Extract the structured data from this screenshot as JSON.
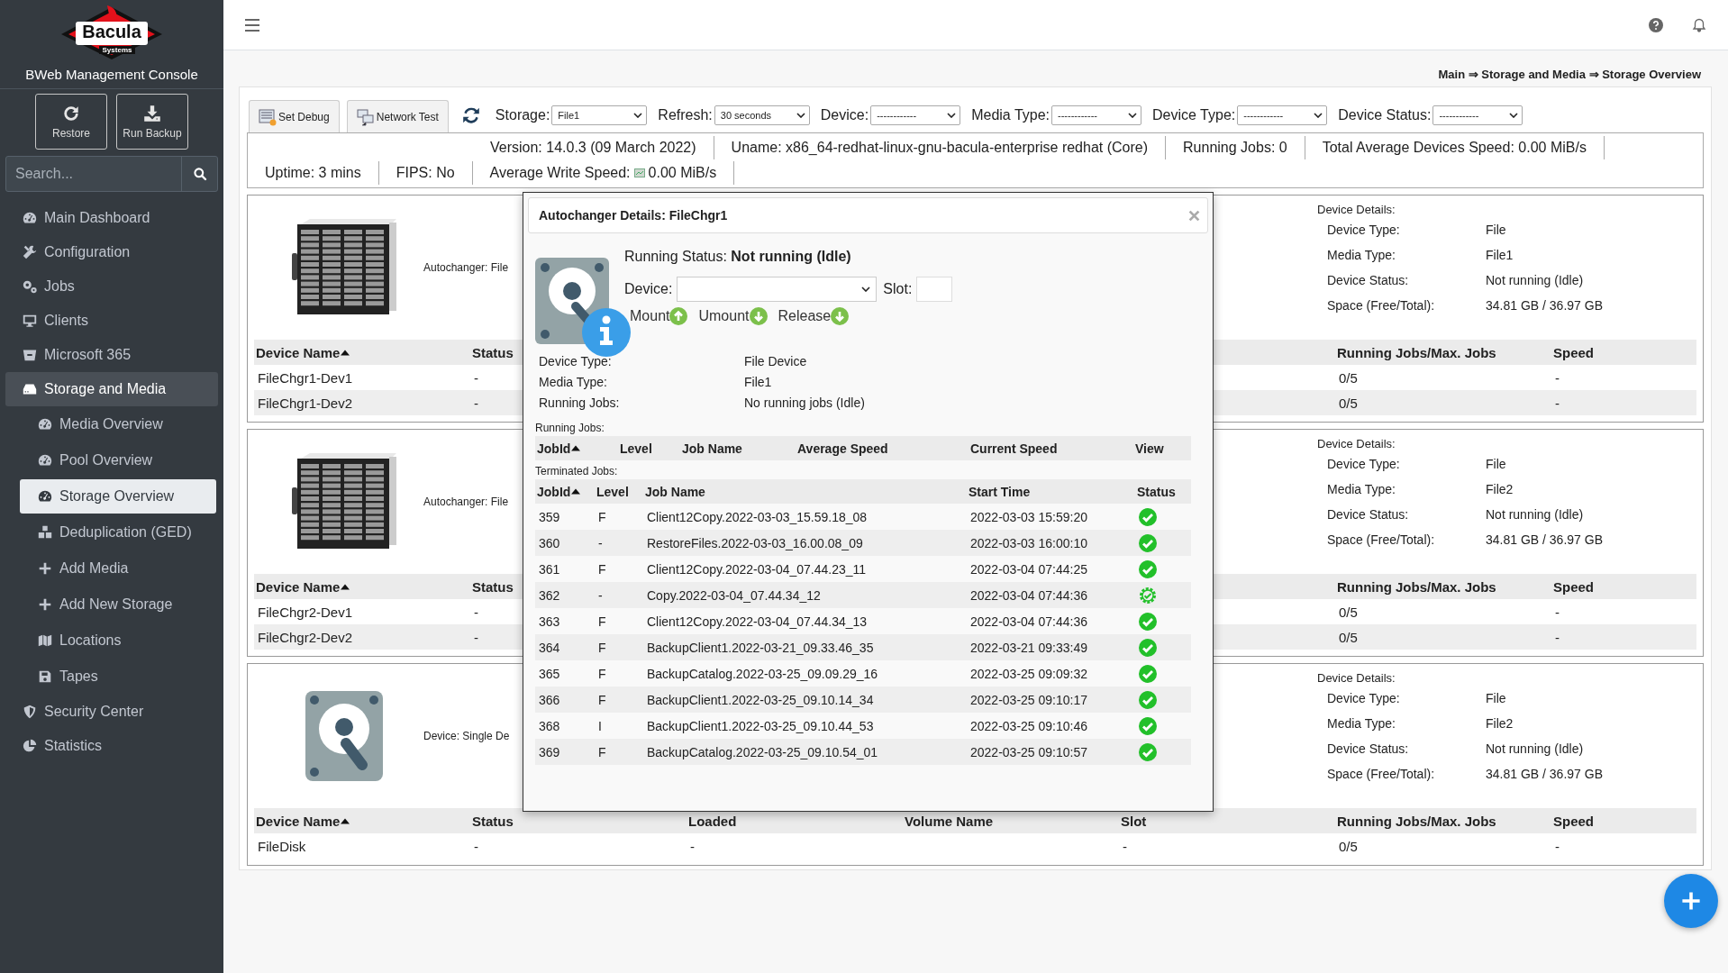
{
  "logo": {
    "name": "Bacula",
    "tagline": "Systems"
  },
  "app_title": "BWeb Management Console",
  "quick_buttons": [
    "Restore",
    "Run Backup"
  ],
  "search": {
    "placeholder": "Search..."
  },
  "sidebar": {
    "items": [
      {
        "label": "Main Dashboard",
        "expanded": false
      },
      {
        "label": "Configuration",
        "expanded": false
      },
      {
        "label": "Jobs",
        "expanded": false
      },
      {
        "label": "Clients",
        "expanded": false
      },
      {
        "label": "Microsoft 365",
        "expanded": false
      },
      {
        "label": "Storage and Media",
        "expanded": true,
        "children": [
          {
            "label": "Media Overview",
            "selected": false
          },
          {
            "label": "Pool Overview",
            "selected": false
          },
          {
            "label": "Storage Overview",
            "selected": true
          },
          {
            "label": "Deduplication (GED)",
            "selected": false
          },
          {
            "label": "Add Media",
            "selected": false
          },
          {
            "label": "Add New Storage",
            "selected": false
          },
          {
            "label": "Locations",
            "selected": false
          },
          {
            "label": "Tapes",
            "selected": false
          }
        ]
      },
      {
        "label": "Security Center",
        "expanded": false
      },
      {
        "label": "Statistics",
        "expanded": false
      }
    ]
  },
  "breadcrumb": "Main ⇒ Storage and Media ⇒ Storage Overview",
  "toolbar": {
    "buttons": [
      "Set Debug",
      "Network Test"
    ],
    "filters": [
      {
        "label": "Storage:",
        "value": "File1"
      },
      {
        "label": "Refresh:",
        "value": "30 seconds"
      },
      {
        "label": "Device:",
        "value": "------------"
      },
      {
        "label": "Media Type:",
        "value": "------------"
      },
      {
        "label": "Device Type:",
        "value": "------------"
      },
      {
        "label": "Device Status:",
        "value": "------------"
      }
    ]
  },
  "info_rows": [
    [
      {
        "kind": "plain",
        "text": "Version: 14.0.3 (09 March 2022)"
      },
      {
        "kind": "plain",
        "text": "Uname: x86_64-redhat-linux-gnu-bacula-enterprise redhat (Core)"
      },
      {
        "kind": "plain",
        "text": "Running Jobs: 0"
      },
      {
        "kind": "plain",
        "text": "Total Average Devices Speed: 0.00 MiB/s"
      }
    ],
    [
      {
        "kind": "plain",
        "text": "Uptime: 3 mins"
      },
      {
        "kind": "plain",
        "text": "FIPS: No"
      },
      {
        "kind": "speed",
        "text": "Average Write Speed:",
        "value": "0.00 MiB/s"
      }
    ]
  ],
  "cards": [
    {
      "kind": "autochanger",
      "label": "Autochanger: File",
      "details_title": "Device Details:",
      "details": [
        {
          "label": "Device Type:",
          "value": "File"
        },
        {
          "label": "Media Type:",
          "value": "File1"
        },
        {
          "label": "Device Status:",
          "value": "Not running (Idle)"
        },
        {
          "label": "Space (Free/Total):",
          "value": "34.81 GB / 36.97 GB"
        }
      ],
      "columns": [
        {
          "label": "Device Name",
          "sorted": true
        },
        {
          "label": "Status",
          "sorted": false
        },
        null,
        null,
        null,
        {
          "label": "Running Jobs/Max. Jobs",
          "sorted": false
        },
        {
          "label": "Speed",
          "sorted": false
        }
      ],
      "rows": [
        [
          "FileChgr1-Dev1",
          "-",
          null,
          null,
          null,
          "0/5",
          "-"
        ],
        [
          "FileChgr1-Dev2",
          "-",
          null,
          null,
          null,
          "0/5",
          "-"
        ]
      ]
    },
    {
      "kind": "autochanger",
      "label": "Autochanger: File",
      "details_title": "Device Details:",
      "details": [
        {
          "label": "Device Type:",
          "value": "File"
        },
        {
          "label": "Media Type:",
          "value": "File2"
        },
        {
          "label": "Device Status:",
          "value": "Not running (Idle)"
        },
        {
          "label": "Space (Free/Total):",
          "value": "34.81 GB / 36.97 GB"
        }
      ],
      "columns": [
        {
          "label": "Device Name",
          "sorted": true
        },
        {
          "label": "Status",
          "sorted": false
        },
        null,
        null,
        null,
        {
          "label": "Running Jobs/Max. Jobs",
          "sorted": false
        },
        {
          "label": "Speed",
          "sorted": false
        }
      ],
      "rows": [
        [
          "FileChgr2-Dev1",
          "-",
          null,
          null,
          null,
          "0/5",
          "-"
        ],
        [
          "FileChgr2-Dev2",
          "-",
          null,
          null,
          null,
          "0/5",
          "-"
        ]
      ]
    },
    {
      "kind": "device",
      "label": "Device: Single De",
      "details_title": "Device Details:",
      "details": [
        {
          "label": "Device Type:",
          "value": "File"
        },
        {
          "label": "Media Type:",
          "value": "File2"
        },
        {
          "label": "Device Status:",
          "value": "Not running (Idle)"
        },
        {
          "label": "Space (Free/Total):",
          "value": "34.81 GB / 36.97 GB"
        }
      ],
      "columns": [
        {
          "label": "Device Name",
          "sorted": true
        },
        {
          "label": "Status",
          "sorted": false
        },
        {
          "label": "Loaded",
          "sorted": false
        },
        {
          "label": "Volume Name",
          "sorted": false
        },
        {
          "label": "Slot",
          "sorted": false
        },
        {
          "label": "Running Jobs/Max. Jobs",
          "sorted": false
        },
        {
          "label": "Speed",
          "sorted": false
        }
      ],
      "rows": [
        [
          "FileDisk",
          "-",
          "-",
          null,
          "-",
          "0/5",
          "-"
        ]
      ]
    }
  ],
  "modal": {
    "title": "Autochanger Details: FileChgr1",
    "running_status": "Running Status: **Not running (Idle)**",
    "device_label": "Device:",
    "slot_label": "Slot:",
    "actions": [
      {
        "label": "Mount",
        "kind": "up"
      },
      {
        "label": "Umount",
        "kind": "down"
      },
      {
        "label": "Release",
        "kind": "down"
      }
    ],
    "details": [
      {
        "label": "Device Type:",
        "value": "File Device"
      },
      {
        "label": "Media Type:",
        "value": "File1"
      },
      {
        "label": "Running Jobs:",
        "value": "No running jobs (Idle)"
      }
    ],
    "running_jobs": {
      "title": "Running Jobs:",
      "columns": [
        {
          "label": "JobId",
          "sorted": true
        },
        {
          "label": "Level",
          "sorted": false
        },
        {
          "label": "Job Name",
          "sorted": false
        },
        {
          "label": "Average Speed",
          "sorted": false
        },
        {
          "label": "Current Speed",
          "sorted": false
        },
        {
          "label": "View",
          "sorted": false
        }
      ]
    },
    "terminated_jobs": {
      "title": "Terminated Jobs:",
      "columns": [
        {
          "label": "JobId",
          "sorted": true
        },
        {
          "label": "Level",
          "sorted": false
        },
        {
          "label": "Job Name",
          "sorted": false
        },
        {
          "label": "Start Time",
          "sorted": false
        },
        {
          "label": "Status",
          "sorted": false
        }
      ],
      "rows": [
        {
          "jobid": "359",
          "level": "F",
          "job_name": "Client12Copy.2022-03-03_15.59.18_08",
          "start_time": "2022-03-03 15:59:20",
          "kind": "ok"
        },
        {
          "jobid": "360",
          "level": "-",
          "job_name": "RestoreFiles.2022-03-03_16.00.08_09",
          "start_time": "2022-03-03 16:00:10",
          "kind": "ok"
        },
        {
          "jobid": "361",
          "level": "F",
          "job_name": "Client12Copy.2022-03-04_07.44.23_11",
          "start_time": "2022-03-04 07:44:25",
          "kind": "ok"
        },
        {
          "jobid": "362",
          "level": "-",
          "job_name": "Copy.2022-03-04_07.44.34_12",
          "start_time": "2022-03-04 07:44:36",
          "kind": "ok_copy"
        },
        {
          "jobid": "363",
          "level": "F",
          "job_name": "Client12Copy.2022-03-04_07.44.34_13",
          "start_time": "2022-03-04 07:44:36",
          "kind": "ok"
        },
        {
          "jobid": "364",
          "level": "F",
          "job_name": "BackupClient1.2022-03-21_09.33.46_35",
          "start_time": "2022-03-21 09:33:49",
          "kind": "ok"
        },
        {
          "jobid": "365",
          "level": "F",
          "job_name": "BackupCatalog.2022-03-25_09.09.29_16",
          "start_time": "2022-03-25 09:09:32",
          "kind": "ok"
        },
        {
          "jobid": "366",
          "level": "F",
          "job_name": "BackupClient1.2022-03-25_09.10.14_34",
          "start_time": "2022-03-25 09:10:17",
          "kind": "ok"
        },
        {
          "jobid": "368",
          "level": "I",
          "job_name": "BackupClient1.2022-03-25_09.10.44_53",
          "start_time": "2022-03-25 09:10:46",
          "kind": "ok"
        },
        {
          "jobid": "369",
          "level": "F",
          "job_name": "BackupCatalog.2022-03-25_09.10.54_01",
          "start_time": "2022-03-25 09:10:57",
          "kind": "ok"
        }
      ]
    }
  }
}
